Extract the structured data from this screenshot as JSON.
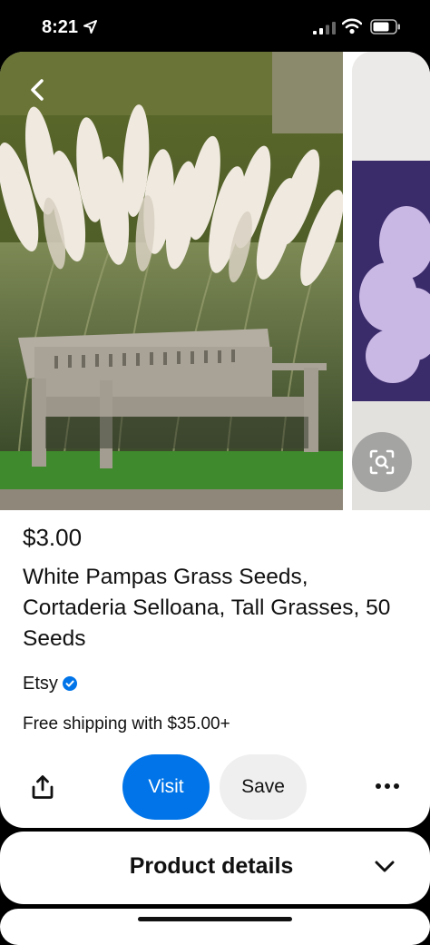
{
  "status_bar": {
    "time": "8:21"
  },
  "product": {
    "price": "$3.00",
    "title": "White Pampas Grass Seeds, Cortaderia Selloana, Tall Grasses, 50 Seeds",
    "brand": "Etsy",
    "shipping": "Free shipping with $35.00+"
  },
  "actions": {
    "visit_label": "Visit",
    "save_label": "Save"
  },
  "details": {
    "label": "Product details"
  },
  "icons": {
    "back": "chevron-left-icon",
    "lens": "visual-search-icon",
    "share": "share-icon",
    "more": "more-icon",
    "expand": "chevron-down-icon",
    "verified": "verified-badge-icon"
  },
  "colors": {
    "accent": "#0074e8",
    "verified": "#0074e8"
  }
}
